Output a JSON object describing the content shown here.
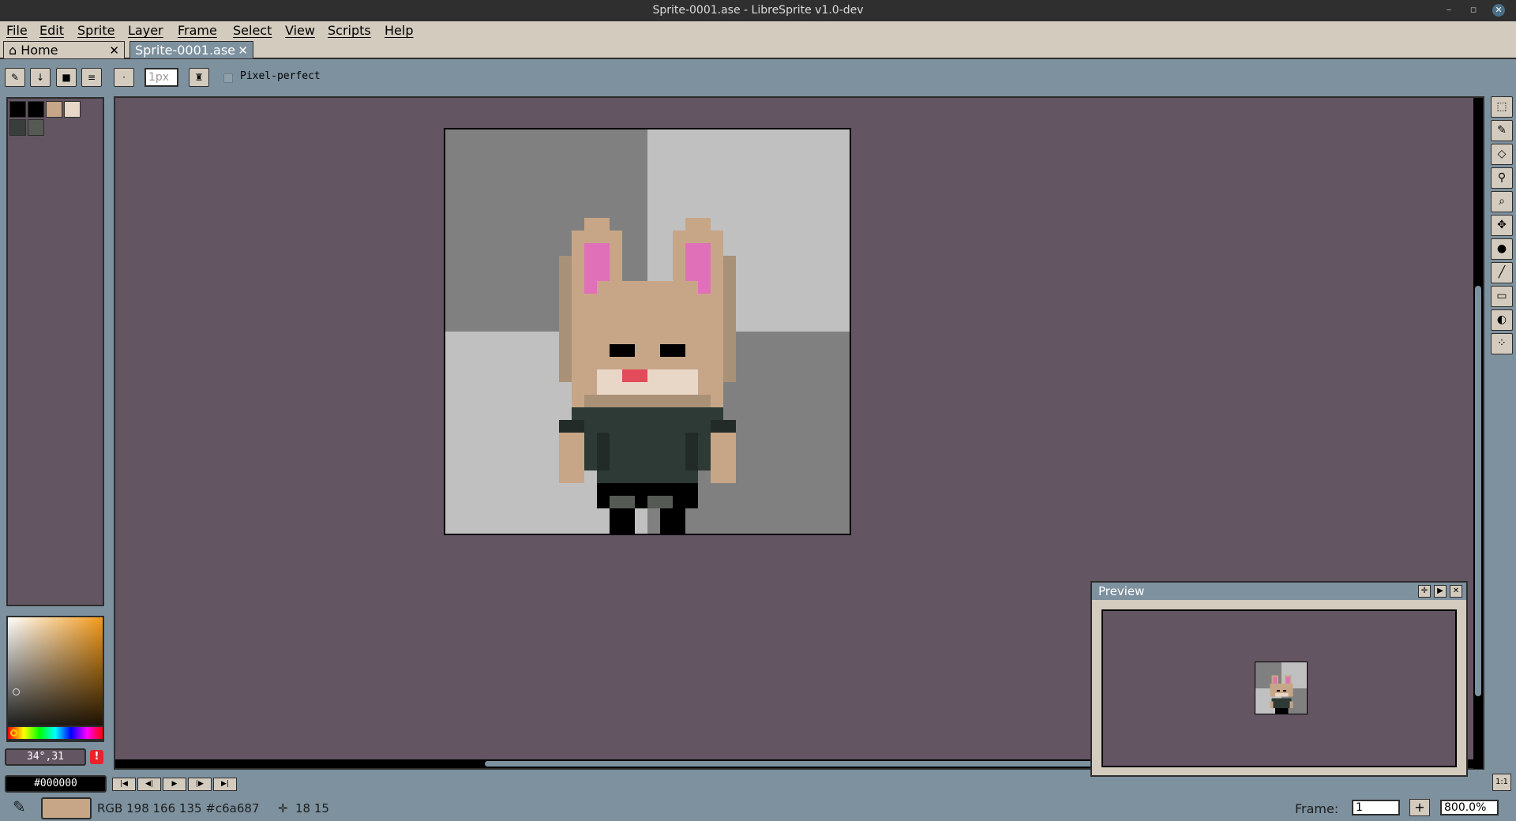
{
  "window": {
    "title": "Sprite-0001.ase - LibreSprite v1.0-dev"
  },
  "menu": [
    "File",
    "Edit",
    "Sprite",
    "Layer",
    "Frame",
    "Select",
    "View",
    "Scripts",
    "Help"
  ],
  "tabs": {
    "home": "Home",
    "active": "Sprite-0001.ase"
  },
  "toolbar": {
    "brush_size": "1px",
    "pixel_perfect_label": "Pixel-perfect"
  },
  "palette": {
    "swatches": [
      "#000000",
      "#000000",
      "#c6a687",
      "#e8d7c6",
      "#3a3e3b",
      "#555a55"
    ],
    "color_picker": {
      "hue_color": "#f39a1a"
    }
  },
  "color_fields": {
    "hsv": "34°,31",
    "warning": "!",
    "hex": "#000000"
  },
  "preview": {
    "title": "Preview"
  },
  "status": {
    "color_info": "RGB 198 166 135 #c6a687",
    "position": "18 15",
    "frame_label": "Frame:",
    "frame_value": "1",
    "zoom": "800.0%",
    "one_to_one": "1:1"
  },
  "colors": {
    "workspace": "#645563",
    "panel": "#7d929e",
    "menu": "#d3cbbe",
    "fur": "#c6a687",
    "fur_dark": "#a89177",
    "ear_inner": "#e070b8",
    "muzzle": "#e8d7c6",
    "nose": "#e14b5a",
    "shirt": "#2e3a35",
    "shirt_dark": "#222b27",
    "boots": "#000000",
    "boots_light": "#555a55",
    "checker_dark": "#808080",
    "checker_light": "#c0c0c0"
  }
}
